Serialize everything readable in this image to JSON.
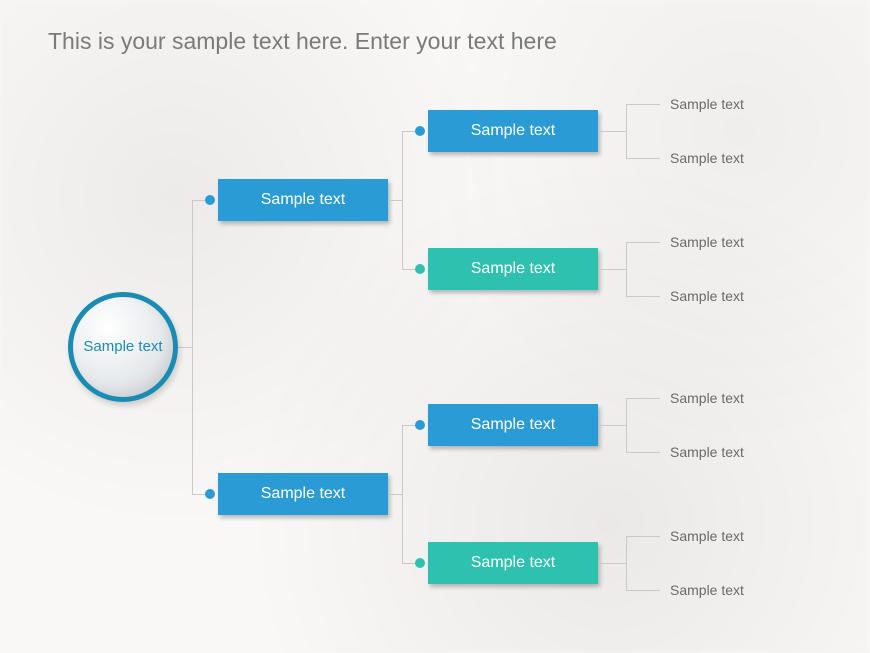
{
  "title": "This is your sample text here. Enter your text here",
  "root": {
    "label": "Sample text"
  },
  "level2": [
    {
      "label": "Sample text",
      "color": "blue"
    },
    {
      "label": "Sample text",
      "color": "blue"
    }
  ],
  "level3": [
    {
      "label": "Sample text",
      "color": "blue"
    },
    {
      "label": "Sample text",
      "color": "teal"
    },
    {
      "label": "Sample text",
      "color": "blue"
    },
    {
      "label": "Sample text",
      "color": "teal"
    }
  ],
  "leaves": [
    {
      "label": "Sample text"
    },
    {
      "label": "Sample text"
    },
    {
      "label": "Sample text"
    },
    {
      "label": "Sample text"
    },
    {
      "label": "Sample text"
    },
    {
      "label": "Sample text"
    },
    {
      "label": "Sample text"
    },
    {
      "label": "Sample text"
    }
  ],
  "colors": {
    "blue": "#2b9bd6",
    "teal": "#2fc1b0",
    "title": "#7a7a7a",
    "leaf": "#6a6a6a",
    "line": "#c9c9c9",
    "rootBorder": "#1a8cb3"
  }
}
